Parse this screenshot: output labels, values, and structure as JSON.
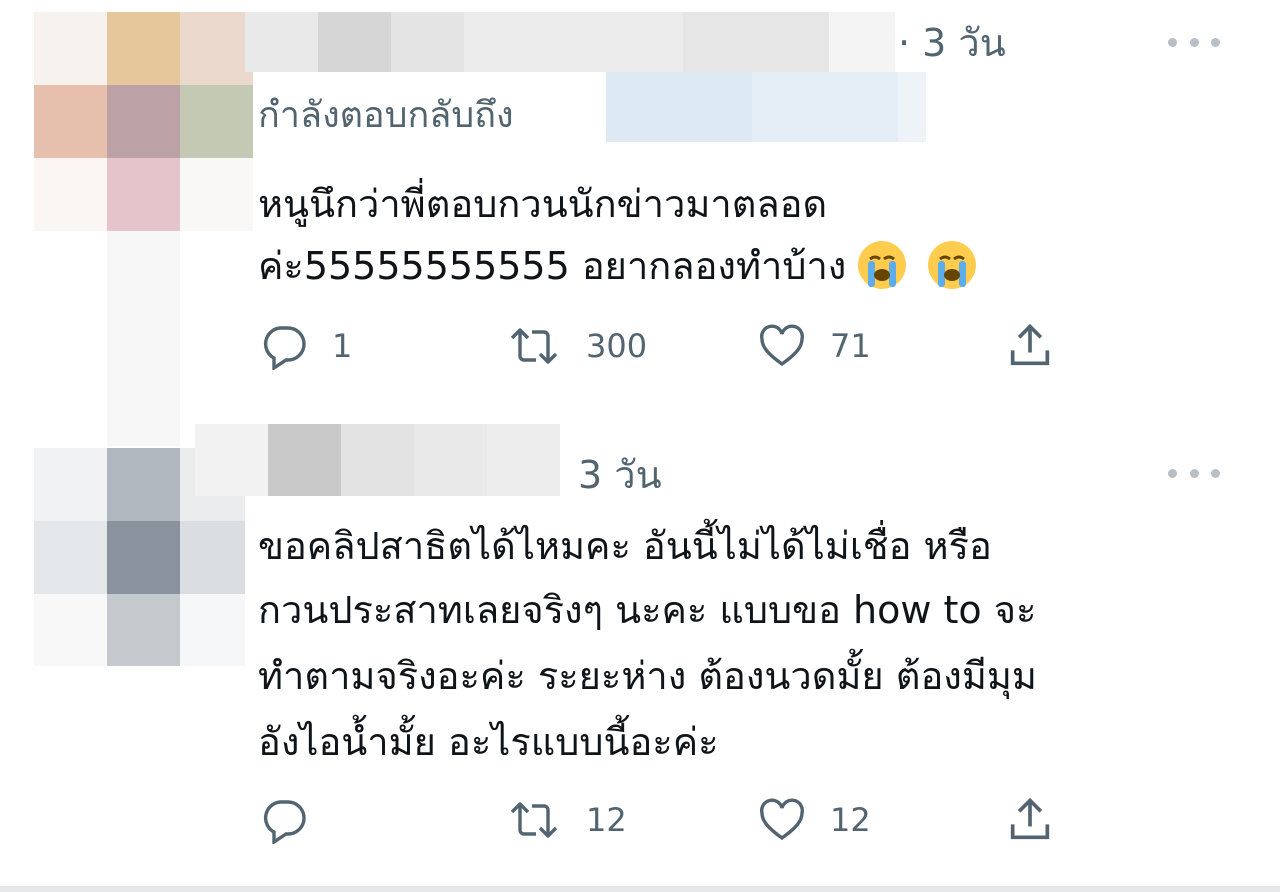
{
  "tweets": [
    {
      "time": "· 3 วัน",
      "replying_to": "กำลังตอบกลับถึง",
      "text_lines": [
        "หนูนึกว่าพี่ตอบกวนนักข่าวมาตลอด",
        "ค่ะ55555555555 อยากลองทำบ้าง"
      ],
      "emoji": [
        "loudly-crying-face",
        "loudly-crying-face"
      ],
      "actions": {
        "reply_count": "1",
        "retweet_count": "300",
        "like_count": "71"
      }
    },
    {
      "time": "3 วัน",
      "text_lines": [
        "ขอคลิปสาธิตได้ไหมคะ อันนี้ไม่ได้ไม่เชื่อ หรือ",
        "กวนประสาทเลยจริงๆ นะคะ แบบขอ how to จะ",
        "ทำตามจริงอะค่ะ ระยะห่าง ต้องนวดมั้ย ต้องมีมุม",
        "อังไอน้ำมั้ย อะไรแบบนี้อะค่ะ"
      ],
      "actions": {
        "reply_count": "",
        "retweet_count": "12",
        "like_count": "12"
      }
    }
  ],
  "colors": {
    "text": "#0f1419",
    "secondary": "#536471",
    "background": "#ffffff"
  }
}
